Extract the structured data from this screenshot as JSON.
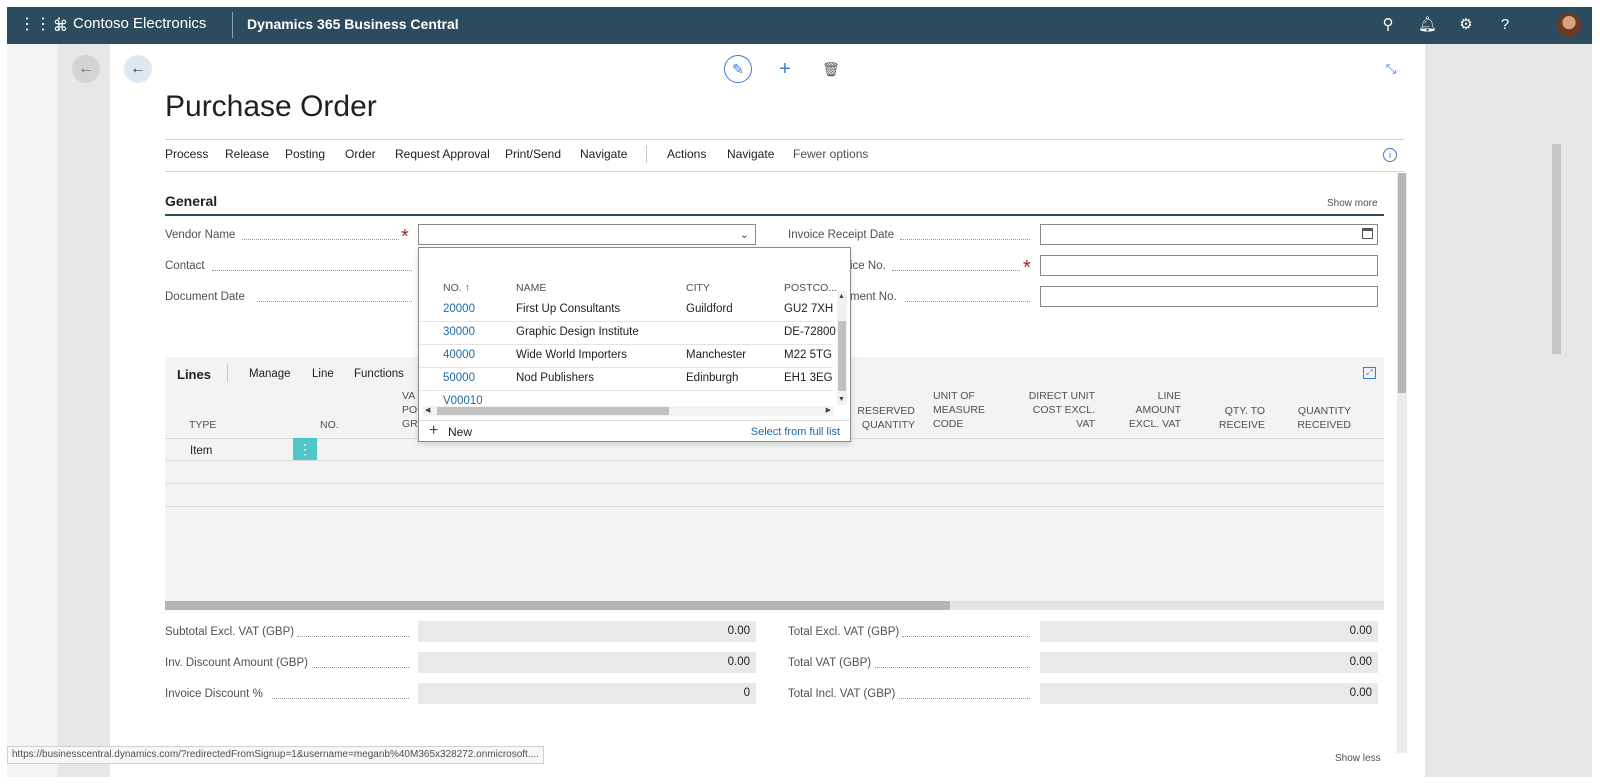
{
  "app": {
    "org_name": "Contoso Electronics",
    "product": "Dynamics 365 Business Central"
  },
  "topbar_icons": [
    "search-icon",
    "bell-icon",
    "gear-icon",
    "help-icon"
  ],
  "page": {
    "title": "Purchase Order"
  },
  "actions": [
    "Process",
    "Release",
    "Posting",
    "Order",
    "Request Approval",
    "Print/Send",
    "Navigate",
    "Actions",
    "Navigate",
    "Fewer options"
  ],
  "general": {
    "title": "General",
    "show_more": "Show more",
    "vendor_name_label": "Vendor Name",
    "contact_label": "Contact",
    "document_date_label": "Document Date",
    "invoice_receipt_date_label": "Invoice Receipt Date",
    "vendor_invoice_no_label": "ice No.",
    "vendor_shipment_no_label": "ment No."
  },
  "vendor_dropdown": {
    "columns": [
      "NO. ↑",
      "NAME",
      "CITY",
      "POSTCO..."
    ],
    "rows": [
      {
        "no": "20000",
        "name": "First Up Consultants",
        "city": "Guildford",
        "postcode": "GU2 7XH"
      },
      {
        "no": "30000",
        "name": "Graphic Design Institute",
        "city": "",
        "postcode": "DE-72800"
      },
      {
        "no": "40000",
        "name": "Wide World Importers",
        "city": "Manchester",
        "postcode": "M22 5TG"
      },
      {
        "no": "50000",
        "name": "Nod Publishers",
        "city": "Edinburgh",
        "postcode": "EH1 3EG"
      },
      {
        "no": "V00010",
        "name": "",
        "city": "",
        "postcode": ""
      }
    ],
    "new_label": "New",
    "select_full_list": "Select from full list"
  },
  "lines": {
    "title": "Lines",
    "actions": [
      "Manage",
      "Line",
      "Functions"
    ],
    "columns": {
      "type": "TYPE",
      "no": "NO.",
      "vat_partial_1": "VA",
      "vat_partial_2": "PO",
      "vat_partial_3": "GR",
      "reserved_quantity": [
        "RESERVED",
        "QUANTITY"
      ],
      "unit_of_measure_code": [
        "UNIT OF",
        "MEASURE",
        "CODE"
      ],
      "direct_unit_cost": [
        "DIRECT UNIT",
        "COST EXCL.",
        "VAT"
      ],
      "line_amount": [
        "LINE",
        "AMOUNT",
        "EXCL. VAT"
      ],
      "qty_to_receive": [
        "QTY. TO",
        "RECEIVE"
      ],
      "quantity_received": [
        "QUANTITY",
        "RECEIVED"
      ]
    },
    "row_type": "Item",
    "kebab": "⋮"
  },
  "totals": {
    "subtotal_label": "Subtotal Excl. VAT (GBP)",
    "subtotal_value": "0.00",
    "inv_discount_label": "Inv. Discount Amount (GBP)",
    "inv_discount_value": "0.00",
    "invoice_discount_pct_label": "Invoice Discount %",
    "invoice_discount_pct_value": "0",
    "total_excl_label": "Total Excl. VAT (GBP)",
    "total_excl_value": "0.00",
    "total_vat_label": "Total VAT (GBP)",
    "total_vat_value": "0.00",
    "total_incl_label": "Total Incl. VAT (GBP)",
    "total_incl_value": "0.00"
  },
  "status_url": "https://businesscentral.dynamics.com/?redirectedFromSignup=1&username=meganb%40M365x328272.onmicrosoft....",
  "show_less": "Show less",
  "colors": {
    "topbar": "#2c4b5e",
    "link": "#1f6aa5",
    "required": "#a4262c",
    "kebab": "#4fc7c9"
  }
}
